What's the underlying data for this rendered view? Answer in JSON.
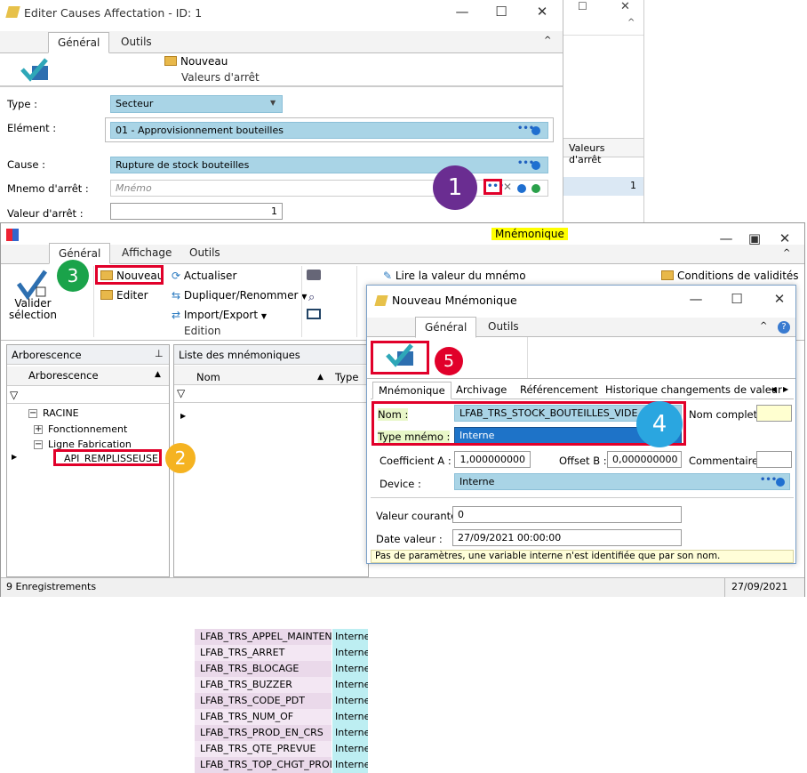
{
  "win1": {
    "title": "Editer Causes Affectation - ID: 1",
    "tabs": [
      "Général",
      "Outils"
    ],
    "toolbar": {
      "nouveau": "Nouveau",
      "group": "Valeurs d'arrêt"
    },
    "labels": {
      "type": "Type :",
      "element": "Elément :",
      "cause": "Cause :",
      "mnemo": "Mnemo d'arrêt :",
      "valeur": "Valeur d'arrêt :"
    },
    "values": {
      "type": "Secteur",
      "element": "01 - Approvisionnement bouteilles",
      "cause": "Rupture de stock bouteilles",
      "mnemo_placeholder": "Mnémo",
      "valeur": "1"
    }
  },
  "bgwin": {
    "col_header": "Valeurs d'arrêt",
    "cell": "1"
  },
  "win2": {
    "title_badge": "Mnémonique",
    "tabs": [
      "Général",
      "Affichage",
      "Outils"
    ],
    "toolbar": {
      "valider": "Valider sélection",
      "nouveau": "Nouveau",
      "editer": "Editer",
      "actualiser": "Actualiser",
      "dupliquer": "Dupliquer/Renommer",
      "import": "Import/Export",
      "group_edition": "Edition",
      "lire": "Lire la valeur du mnémo",
      "conditions": "Conditions de validités"
    },
    "tree": {
      "panel_title": "Arborescence",
      "col": "Arborescence",
      "nodes": [
        "RACINE",
        "Fonctionnement",
        "Ligne Fabrication",
        "API_REMPLISSEUSE"
      ]
    },
    "list": {
      "panel_title": "Liste des mnémoniques",
      "col_nom": "Nom",
      "col_type": "Type",
      "rows": [
        {
          "nom": "LFAB_TRS_APPEL_MAINTENANCE",
          "type": "Interne"
        },
        {
          "nom": "LFAB_TRS_ARRET",
          "type": "Interne"
        },
        {
          "nom": "LFAB_TRS_BLOCAGE",
          "type": "Interne"
        },
        {
          "nom": "LFAB_TRS_BUZZER",
          "type": "Interne"
        },
        {
          "nom": "LFAB_TRS_CODE_PDT",
          "type": "Interne"
        },
        {
          "nom": "LFAB_TRS_NUM_OF",
          "type": "Interne"
        },
        {
          "nom": "LFAB_TRS_PROD_EN_CRS",
          "type": "Interne"
        },
        {
          "nom": "LFAB_TRS_QTE_PREVUE",
          "type": "Interne"
        },
        {
          "nom": "LFAB_TRS_TOP_CHGT_PROD",
          "type": "Interne"
        }
      ]
    },
    "status": {
      "count": "9 Enregistrements",
      "date": "27/09/2021"
    }
  },
  "win3": {
    "title": "Nouveau Mnémonique",
    "tabs": [
      "Général",
      "Outils"
    ],
    "subtabs": [
      "Mnémonique",
      "Archivage",
      "Référencement",
      "Historique changements de valeur"
    ],
    "labels": {
      "nom": "Nom :",
      "nom_complet": "Nom complet :",
      "type_mnemo": "Type mnémo :",
      "coef": "Coefficient A :",
      "offset": "Offset B :",
      "commentaire": "Commentaire :",
      "device": "Device :",
      "valeur_courante": "Valeur courante :",
      "date_valeur": "Date valeur :"
    },
    "values": {
      "nom": "LFAB_TRS_STOCK_BOUTEILLES_VIDE",
      "type_mnemo": "Interne",
      "coef": "1,000000000",
      "offset": "0,000000000",
      "device": "Interne",
      "valeur_courante": "0",
      "date_valeur": "27/09/2021 00:00:00"
    },
    "hint": "Pas de paramètres, une variable interne n'est identifiée que par son nom."
  },
  "badges": [
    "1",
    "2",
    "3",
    "4",
    "5"
  ],
  "colors": {
    "purple": "#6a2d91",
    "orange": "#f5b321",
    "green": "#1aa34a",
    "blue": "#2aa6e0",
    "red": "#e1002a"
  }
}
